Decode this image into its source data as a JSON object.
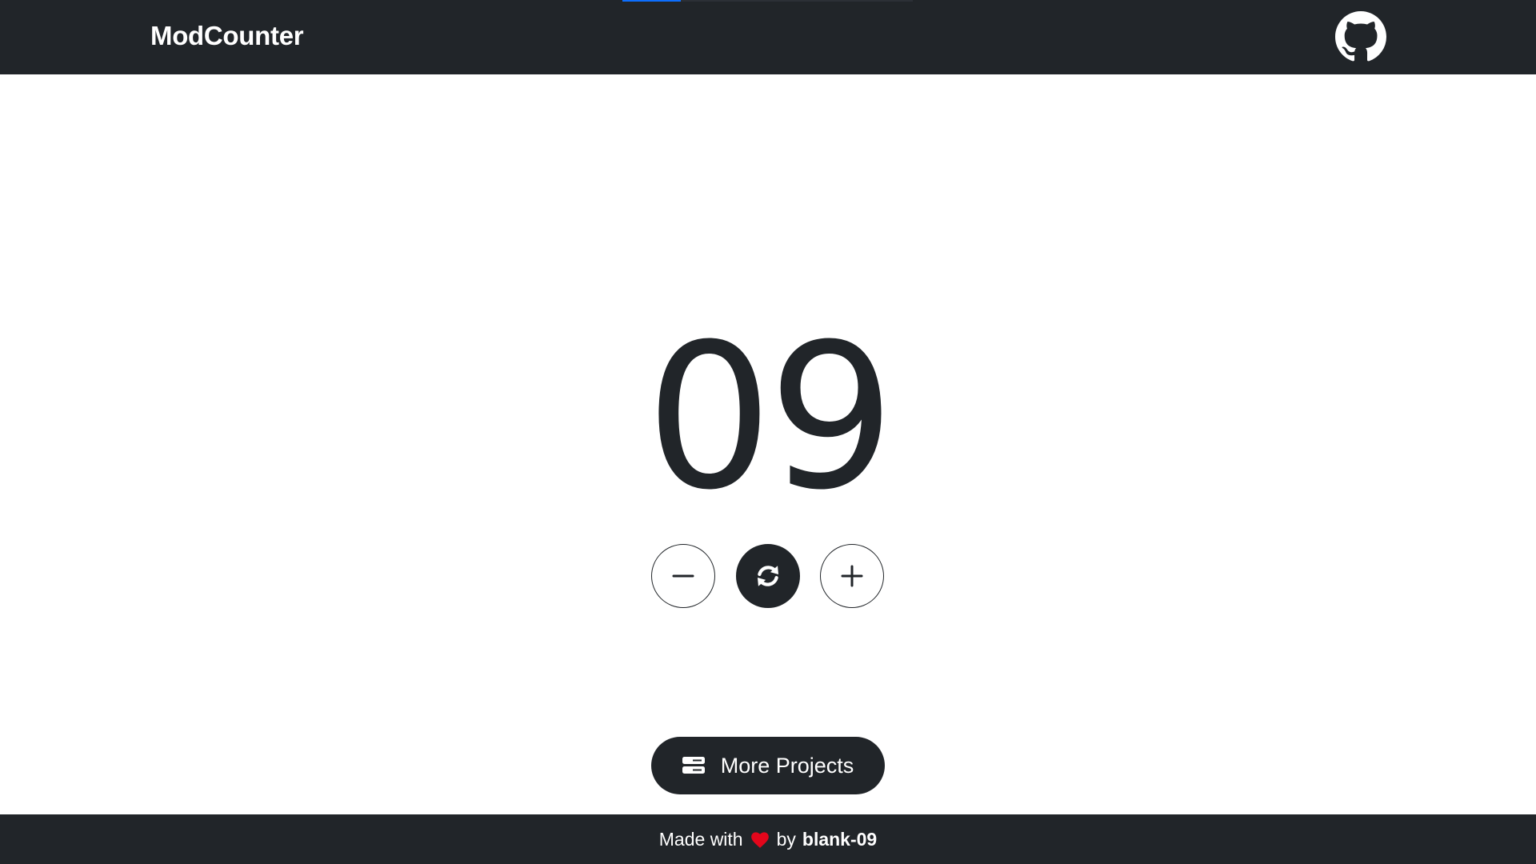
{
  "navbar": {
    "brand": "ModCounter",
    "github_icon": "github-icon",
    "loading_progress": 0.2,
    "colors": {
      "background": "#212529",
      "progress": "#0d6efd"
    }
  },
  "counter": {
    "value": "09"
  },
  "controls": {
    "decrement_icon": "minus-icon",
    "reset_icon": "refresh-icon",
    "increment_icon": "plus-icon"
  },
  "more_projects": {
    "label": "More Projects",
    "icon": "server-icon"
  },
  "footer": {
    "made_with": "Made with",
    "heart_icon": "heart-icon",
    "by": "by",
    "author": "blank-09",
    "colors": {
      "heart": "#e3061b"
    }
  }
}
